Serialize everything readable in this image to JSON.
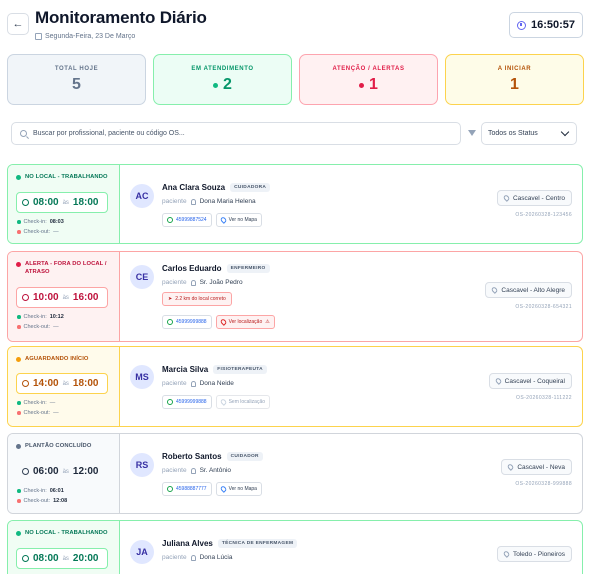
{
  "header": {
    "back_icon": "arrow-left-icon",
    "title": "Monitoramento Diário",
    "date": "Segunda-Feira, 23 De Março",
    "clock": "16:50:57"
  },
  "stats": [
    {
      "label": "TOTAL HOJE",
      "value": "5",
      "color": "#64748b",
      "bg": "#f1f5f9",
      "border": "#cbd5e1"
    },
    {
      "label": "EM ATENDIMENTO",
      "value": "2",
      "color": "#059669",
      "bg": "#ecfdf5",
      "border": "#86efac",
      "dot": "#10b981"
    },
    {
      "label": "ATENÇÃO / ALERTAS",
      "value": "1",
      "color": "#e11d48",
      "bg": "#fff1f2",
      "border": "#fda4af",
      "dot": "#e11d48"
    },
    {
      "label": "A INICIAR",
      "value": "1",
      "color": "#b45309",
      "bg": "#fefce8",
      "border": "#fcd34d"
    }
  ],
  "search": {
    "placeholder": "Buscar por profissional, paciente ou código OS..."
  },
  "filter": {
    "selected": "Todos os Status"
  },
  "labels": {
    "as": "às",
    "checkin": "Check-in:",
    "checkout": "Check-out:",
    "paciente": "paciente"
  },
  "shifts": [
    {
      "status": "NO LOCAL - TRABALHANDO",
      "start": "08:00",
      "end": "18:00",
      "checkin": "08:03",
      "checkout": "—",
      "initials": "AC",
      "name": "Ana Clara Souza",
      "role": "CUIDADORA",
      "patient": "Dona Maria Helena",
      "phone": "45999887524",
      "map": "Ver no Mapa",
      "location": "Cascavel - Centro",
      "os": "OS-20260328-123456"
    },
    {
      "status": "ALERTA - FORA DO LOCAL / ATRASO",
      "start": "10:00",
      "end": "16:00",
      "checkin": "10:12",
      "checkout": "—",
      "initials": "CE",
      "name": "Carlos Eduardo",
      "role": "ENFERMEIRO",
      "patient": "Sr. João Pedro",
      "alert": "2.2 km do local correto",
      "phone": "45999999888",
      "map": "Ver localização",
      "location": "Cascavel - Alto Alegre",
      "os": "OS-20260328-654321"
    },
    {
      "status": "AGUARDANDO INÍCIO",
      "start": "14:00",
      "end": "18:00",
      "checkin": "—",
      "checkout": "—",
      "initials": "MS",
      "name": "Marcia Silva",
      "role": "FISIOTERAPEUTA",
      "patient": "Dona Neide",
      "phone": "45999999888",
      "map": "Sem localização",
      "location": "Cascavel - Coqueiral",
      "os": "OS-20260328-111222"
    },
    {
      "status": "PLANTÃO CONCLUÍDO",
      "start": "06:00",
      "end": "12:00",
      "checkin": "06:01",
      "checkout": "12:08",
      "initials": "RS",
      "name": "Roberto Santos",
      "role": "CUIDADOR",
      "patient": "Sr. Antônio",
      "phone": "45988887777",
      "map": "Ver no Mapa",
      "location": "Cascavel - Neva",
      "os": "OS-20260328-999888"
    },
    {
      "status": "NO LOCAL - TRABALHANDO",
      "start": "08:00",
      "end": "20:00",
      "initials": "JA",
      "name": "Juliana Alves",
      "role": "TÉCNICA DE ENFERMAGEM",
      "patient": "Dona Lúcia",
      "location": "Toledo - Pioneiros"
    }
  ]
}
